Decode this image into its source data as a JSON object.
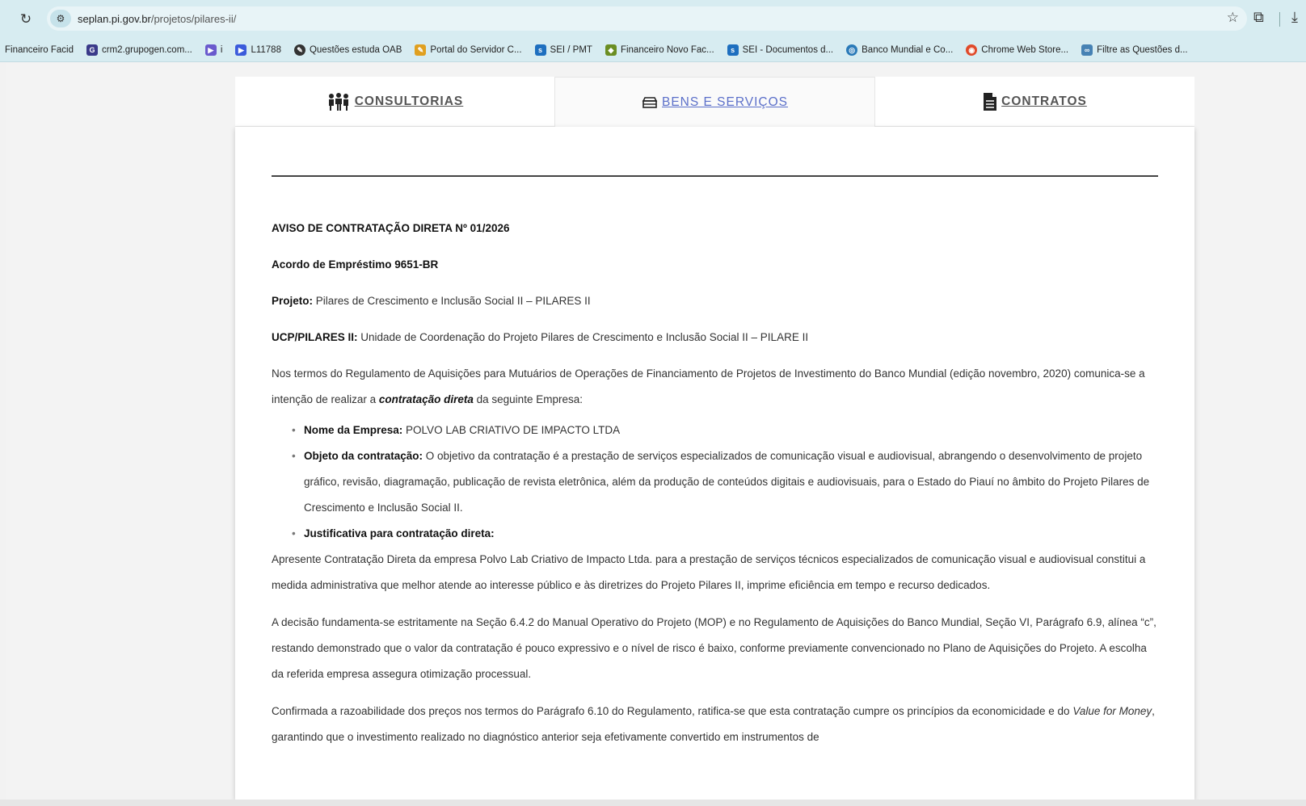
{
  "browser": {
    "url_host": "seplan.pi.gov.br",
    "url_path": "/projetos/pilares-ii/",
    "reload_icon": "reload-icon",
    "bookmarks": [
      {
        "label": "Financeiro Facid",
        "icon_color": ""
      },
      {
        "label": "crm2.grupogen.com...",
        "icon_color": "#3a3a8a"
      },
      {
        "label": "i",
        "icon_color": "#6a5acd"
      },
      {
        "label": "L11788",
        "icon_color": "#3b5bdb"
      },
      {
        "label": "Questões estuda OAB",
        "icon_color": "#333"
      },
      {
        "label": "Portal do Servidor C...",
        "icon_color": "#e0a020"
      },
      {
        "label": "SEI / PMT",
        "icon_color": "#1e6fbf"
      },
      {
        "label": "Financeiro Novo Fac...",
        "icon_color": "#6b8e23"
      },
      {
        "label": "SEI - Documentos d...",
        "icon_color": "#1e6fbf"
      },
      {
        "label": "Banco Mundial e Co...",
        "icon_color": "#2a7ab8"
      },
      {
        "label": "Chrome Web Store...",
        "icon_color": "#e04a2a"
      },
      {
        "label": "Filtre as Questões d...",
        "icon_color": "#4682b4"
      }
    ]
  },
  "tabs": [
    {
      "label": "CONSULTORIAS",
      "icon": "people-icon"
    },
    {
      "label": "BENS E SERVIÇOS",
      "icon": "box-icon"
    },
    {
      "label": "CONTRATOS",
      "icon": "document-icon"
    }
  ],
  "content": {
    "title": "AVISO DE CONTRATAÇÃO DIRETA Nº 01/2026",
    "acordo": "Acordo de Empréstimo 9651-BR",
    "projeto_label": "Projeto:",
    "projeto_value": "  Pilares de Crescimento e Inclusão Social II – PILARES II",
    "ucp_label": "UCP/PILARES II:",
    "ucp_value": " Unidade de Coordenação do Projeto Pilares de Crescimento e Inclusão Social II – PILARE II",
    "intro_pre": "Nos termos do Regulamento de Aquisições para Mutuários de Operações de Financiamento de Projetos de Investimento do Banco Mundial (edição novembro, 2020)  comunica-se a intenção de realizar a ",
    "intro_em": "contratação direta",
    "intro_post": " da seguinte Empresa:",
    "items": [
      {
        "label": "Nome da Empresa:",
        "value": " POLVO LAB CRIATIVO DE IMPACTO LTDA"
      },
      {
        "label": "Objeto da contratação:",
        "value": " O objetivo da contratação é a prestação de serviços especializados de comunicação visual e audiovisual, abrangendo o desenvolvimento de projeto gráfico, revisão, diagramação, publicação de revista eletrônica, além da produção de conteúdos digitais e audiovisuais, para o Estado do Piauí no âmbito do Projeto Pilares de Crescimento e Inclusão Social II."
      },
      {
        "label": "Justificativa para contratação direta:",
        "value": ""
      }
    ],
    "justificativa": "Apresente Contratação Direta da empresa Polvo Lab Criativo de Impacto Ltda. para a prestação de serviços técnicos especializados de comunicação visual e audiovisual constitui a medida administrativa que melhor atende ao interesse público e às diretrizes do Projeto Pilares II, imprime eficiência em tempo e recurso dedicados.",
    "decisao": "A decisão fundamenta-se estritamente na Seção 6.4.2 do Manual Operativo do Projeto (MOP) e no Regulamento de Aquisições do Banco Mundial, Seção VI, Parágrafo 6.9, alínea “c”, restando demonstrado que o valor da contratação é pouco expressivo e o nível de risco é baixo, conforme previamente convencionado no Plano de Aquisições do Projeto. A escolha da referida empresa assegura otimização processual.",
    "confirmada_pre": "Confirmada a razoabilidade dos preços nos termos do Parágrafo 6.10 do Regulamento, ratifica-se que esta contratação cumpre os princípios da economicidade e do ",
    "confirmada_em": "Value for Money",
    "confirmada_post": ", garantindo que o investimento realizado no diagnóstico anterior seja efetivamente convertido em instrumentos de"
  }
}
